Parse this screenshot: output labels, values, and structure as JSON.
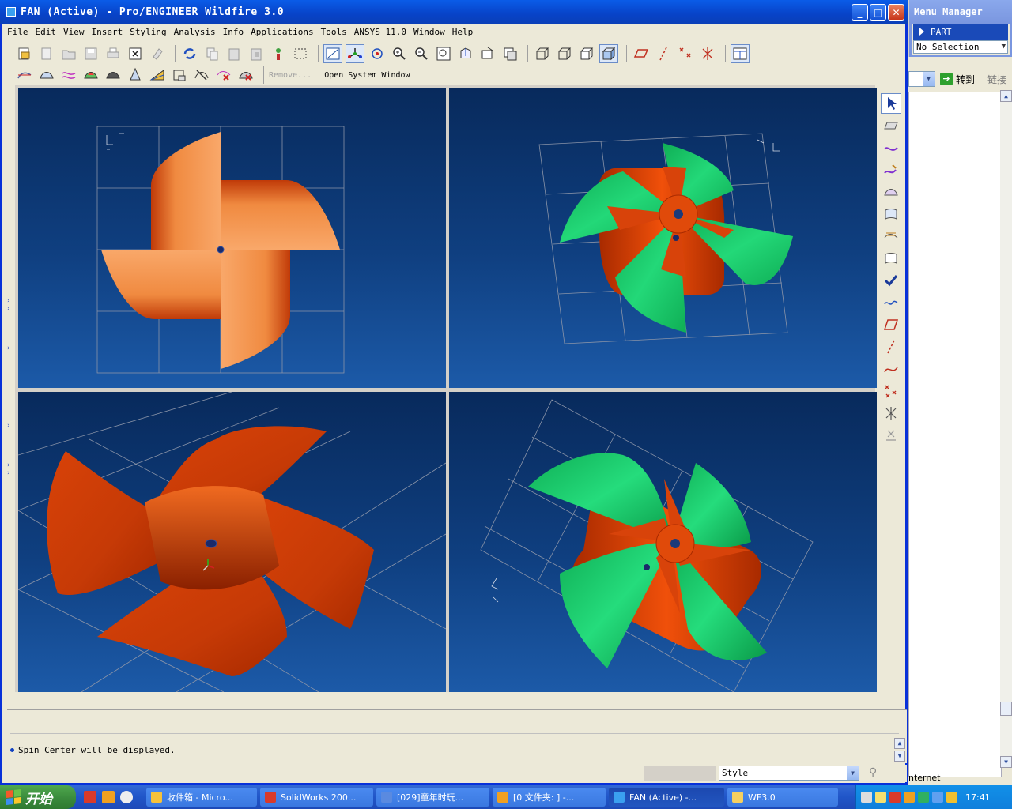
{
  "window": {
    "title": "FAN (Active) - Pro/ENGINEER Wildfire 3.0",
    "btn_minimize": "_",
    "btn_maximize": "□",
    "btn_close": "✕"
  },
  "menu": [
    "File",
    "Edit",
    "View",
    "Insert",
    "Styling",
    "Analysis",
    "Info",
    "Applications",
    "Tools",
    "ANSYS 11.0",
    "Window",
    "Help"
  ],
  "toolbar2": {
    "remove_label": "Remove...",
    "open_system_window_label": "Open System Window"
  },
  "message": {
    "text": "Spin Center will be displayed."
  },
  "status": {
    "filter_value": "Style"
  },
  "menu_manager": {
    "title": "Menu Manager",
    "part_label": "PART",
    "selection_value": "No Selection"
  },
  "browser": {
    "go_label": "转到",
    "links_label": "链接",
    "status_text": "nternet"
  },
  "taskbar": {
    "start_label": "开始",
    "tasks": [
      {
        "label": "收件箱 - Micro...",
        "color": "#f7c23a"
      },
      {
        "label": "SolidWorks 200...",
        "color": "#d83a2a"
      },
      {
        "label": "[029]童年时玩...",
        "color": "#5a8ae0"
      },
      {
        "label": "[0 文件夹: ] -...",
        "color": "#f0a020"
      },
      {
        "label": "FAN (Active) -...",
        "color": "#3aa0f0"
      },
      {
        "label": "WF3.0",
        "color": "#f5d060"
      }
    ],
    "clock": "17:41"
  },
  "colors": {
    "viewport_top": "#082a5c",
    "viewport_bottom": "#1c5aa8",
    "blade_orange": "#cc3a0a",
    "blade_peach": "#f9a86a",
    "blade_green": "#1cd670"
  }
}
